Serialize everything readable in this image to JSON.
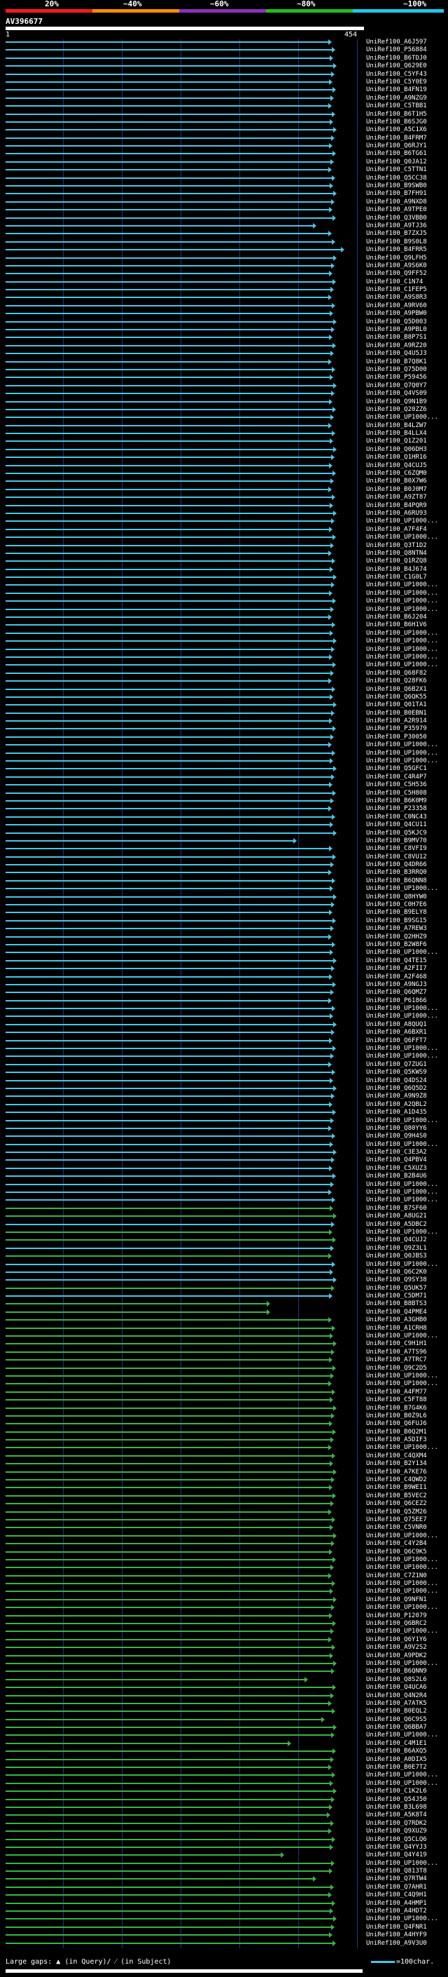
{
  "scale": {
    "ticks": [
      "20%",
      "~40%",
      "~60%",
      "~80%",
      "~100%"
    ],
    "segment_colors": [
      "#ff1a1a",
      "#ff8a00",
      "#8b2fbf",
      "#1fbf1f",
      "#1ec8e6"
    ]
  },
  "query": {
    "id": "AV396677",
    "start": "1",
    "end": "454"
  },
  "colors": {
    "identity_high": "#4bc5e4",
    "identity_mid": "#3ab34a",
    "grid": "#1c3a78",
    "background": "#000000"
  },
  "hits": [
    "UniRef100_A6J597",
    "UniRef100_P56884",
    "UniRef100_B6TDJ0",
    "UniRef100_Q629E0",
    "UniRef100_C5YF43",
    "UniRef100_C5Y0E9",
    "UniRef100_B4FN19",
    "UniRef100_A9NZG9",
    "UniRef100_C5TBB1",
    "UniRef100_B6T1H5",
    "UniRef100_B6SJG0",
    "UniRef100_A5C1X6",
    "UniRef100_B4FRM7",
    "UniRef100_Q6RJY1",
    "UniRef100_B6TG61",
    "UniRef100_Q0JA12",
    "UniRef100_C5TTN1",
    "UniRef100_Q5CC38",
    "UniRef100_B9SWB0",
    "UniRef100_B7FH91",
    "UniRef100_A9NXD8",
    "UniRef100_A9TPE0",
    "UniRef100_Q3VBB0",
    "UniRef100_A9TJ36",
    "UniRef100_B7ZXJ5",
    "UniRef100_B9S0L8",
    "UniRef100_B4FRR5",
    "UniRef100_Q9LFH5",
    "UniRef100_A9S6K0",
    "UniRef100_Q9FF52",
    "UniRef100_C1N74",
    "UniRef100_C1FEP5",
    "UniRef100_A9S8R3",
    "UniRef100_A9RV60",
    "UniRef100_A9PBW0",
    "UniRef100_Q5D003",
    "UniRef100_A9PBL0",
    "UniRef100_B8P7S1",
    "UniRef100_A9RZ20",
    "UniRef100_Q4U5J3",
    "UniRef100_B7Q8K1",
    "UniRef100_Q75D00",
    "UniRef100_P59456",
    "UniRef100_Q7Q0Y7",
    "UniRef100_Q4VS09",
    "UniRef100_Q9N1B9",
    "UniRef100_Q20ZZ6",
    "UniRef100_UP1000...",
    "UniRef100_B4LZW7",
    "UniRef100_B4LLX4",
    "UniRef100_Q1Z201",
    "UniRef100_Q06DH3",
    "UniRef100_Q1HR16",
    "UniRef100_Q4CUJ5",
    "UniRef100_C6ZQM0",
    "UniRef100_B0X7W6",
    "UniRef100_B0J0M7",
    "UniRef100_A9ZT87",
    "UniRef100_B4PQR9",
    "UniRef100_A6RU93",
    "UniRef100_UP1000...",
    "UniRef100_A7F4F4",
    "UniRef100_UP1000...",
    "UniRef100_Q3T1D2",
    "UniRef100_Q8NTN4",
    "UniRef100_Q1RZQ8",
    "UniRef100_B4J674",
    "UniRef100_C1G0L7",
    "UniRef100_UP1000...",
    "UniRef100_UP1000...",
    "UniRef100_UP1000...",
    "UniRef100_UP1000...",
    "UniRef100_B6J204",
    "UniRef100_B6H1V6",
    "UniRef100_UP1000...",
    "UniRef100_UP1000...",
    "UniRef100_UP1000...",
    "UniRef100_UP1000...",
    "UniRef100_UP1000...",
    "UniRef100_Q68F82",
    "UniRef100_Q28FK6",
    "UniRef100_Q6B2X1",
    "UniRef100_Q6QK55",
    "UniRef100_Q01TA1",
    "UniRef100_B0EBN1",
    "UniRef100_A2R914",
    "UniRef100_P35979",
    "UniRef100_P30050",
    "UniRef100_UP1000...",
    "UniRef100_UP1000...",
    "UniRef100_UP1000...",
    "UniRef100_Q5GFC1",
    "UniRef100_C4R4P7",
    "UniRef100_C5H536",
    "UniRef100_C5H808",
    "UniRef100_B6K0M9",
    "UniRef100_P23358",
    "UniRef100_C0NC43",
    "UniRef100_Q4CU11",
    "UniRef100_Q5KJC9",
    "UniRef100_B9MV70",
    "UniRef100_C8VFI9",
    "UniRef100_C8VU12",
    "UniRef100_Q4DR66",
    "UniRef100_B3RRQ0",
    "UniRef100_B6QNN8",
    "UniRef100_UP1000...",
    "UniRef100_Q8HYW0",
    "UniRef100_C0H7E6",
    "UniRef100_B9ELY8",
    "UniRef100_B9SG15",
    "UniRef100_A7REW3",
    "UniRef100_Q2HHZ9",
    "UniRef100_B2W8F6",
    "UniRef100_UP1000...",
    "UniRef100_Q4TE15",
    "UniRef100_A2FII7",
    "UniRef100_A2F468",
    "UniRef100_A9NGJ3",
    "UniRef100_Q6QMZ7",
    "UniRef100_P61866",
    "UniRef100_UP1000...",
    "UniRef100_UP1000...",
    "UniRef100_A8QUQ1",
    "UniRef100_A6BXR1",
    "UniRef100_Q6FFT7",
    "UniRef100_UP1000...",
    "UniRef100_UP1000...",
    "UniRef100_Q7ZUG1",
    "UniRef100_Q5KWS9",
    "UniRef100_Q4DS24",
    "UniRef100_Q6Q5D2",
    "UniRef100_A9N9Z8",
    "UniRef100_A2QBL2",
    "UniRef100_A1D435",
    "UniRef100_UP1000...",
    "UniRef100_Q80YY6",
    "UniRef100_Q9H4S0",
    "UniRef100_UP1000...",
    "UniRef100_C3E3A2",
    "UniRef100_Q4PBV4",
    "UniRef100_C5XUZ3",
    "UniRef100_B2B4U6",
    "UniRef100_UP1000...",
    "UniRef100_UP1000...",
    "UniRef100_UP1000...",
    "UniRef100_B7SF60",
    "UniRef100_A8UG21",
    "UniRef100_A5DBC2",
    "UniRef100_UP1000...",
    "UniRef100_Q4CUJ2",
    "UniRef100_Q9Z3L1",
    "UniRef100_Q0JBS3",
    "UniRef100_UP1000...",
    "UniRef100_Q6C2K0",
    "UniRef100_Q9SY38",
    "UniRef100_Q5UK57",
    "UniRef100_C5DM71",
    "UniRef100_B8BTS3",
    "UniRef100_Q4PME4",
    "UniRef100_A3GHB0",
    "UniRef100_A1CRH8",
    "UniRef100_UP1000...",
    "UniRef100_C9H1H1",
    "UniRef100_A7TS96",
    "UniRef100_A7TRC7",
    "UniRef100_Q9C2D5",
    "UniRef100_UP1000...",
    "UniRef100_UP1000...",
    "UniRef100_A4FM77",
    "UniRef100_C5FT88",
    "UniRef100_B7G4K6",
    "UniRef100_B0Z9L6",
    "UniRef100_Q6FUJ6",
    "UniRef100_B0Q2M1",
    "UniRef100_A5DIF3",
    "UniRef100_UP1000...",
    "UniRef100_C4QXM4",
    "UniRef100_B2Y134",
    "UniRef100_A7KE76",
    "UniRef100_C4QWD2",
    "UniRef100_B9WEI1",
    "UniRef100_B5VEC2",
    "UniRef100_Q6CEZ2",
    "UniRef100_Q5ZM26",
    "UniRef100_Q75EE7",
    "UniRef100_C5VNR0",
    "UniRef100_UP1000...",
    "UniRef100_C4Y2B4",
    "UniRef100_Q6C9K5",
    "UniRef100_UP1000...",
    "UniRef100_UP1000...",
    "UniRef100_C7Z1N0",
    "UniRef100_UP1000...",
    "UniRef100_UP1000...",
    "UniRef100_Q9NFN1",
    "UniRef100_UP1000...",
    "UniRef100_P12079",
    "UniRef100_Q6BRC2",
    "UniRef100_UP1000...",
    "UniRef100_Q6Y1Y6",
    "UniRef100_A9V2S2",
    "UniRef100_A9PDK2",
    "UniRef100_UP1000...",
    "UniRef100_B6QNN9",
    "UniRef100_Q8S2L6",
    "UniRef100_Q4UCA6",
    "UniRef100_Q4N2R4",
    "UniRef100_A7ATK5",
    "UniRef100_B0EQL2",
    "UniRef100_Q6C9S5",
    "UniRef100_Q6BBA7",
    "UniRef100_UP1000...",
    "UniRef100_C4M1E1",
    "UniRef100_B6AXQ5",
    "UniRef100_A0DIX5",
    "UniRef100_B0E7T2",
    "UniRef100_UP1000...",
    "UniRef100_UP1000...",
    "UniRef100_C1K2L6",
    "UniRef100_Q54J50",
    "UniRef100_B3L698",
    "UniRef100_A5K8T4",
    "UniRef100_Q7RDK2",
    "UniRef100_Q9XUZ9",
    "UniRef100_Q5CLQ6",
    "UniRef100_Q4YYJ3",
    "UniRef100_Q4Y419",
    "UniRef100_UP1000...",
    "UniRef100_Q813T8",
    "UniRef100_Q7RTW4",
    "UniRef100_Q7AHR1",
    "UniRef100_C4Q9H1",
    "UniRef100_A4HMP1",
    "UniRef100_A4HDT2",
    "UniRef100_UP1000...",
    "UniRef100_Q4FNR1",
    "UniRef100_A4HYF9",
    "UniRef100_A9V3U0"
  ],
  "legend": {
    "large_gaps_label": "Large gaps:",
    "in_query": "(in Query)/",
    "in_subject": "(in Subject)",
    "scale_label": "=100char."
  }
}
